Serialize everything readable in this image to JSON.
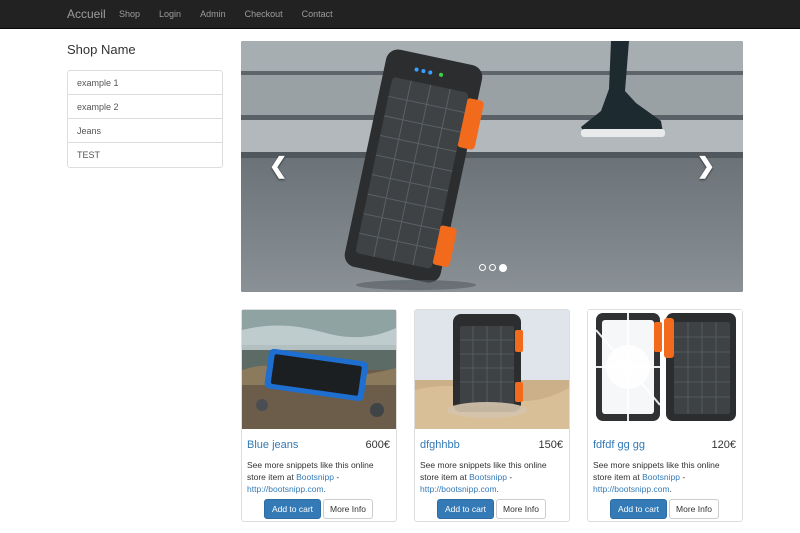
{
  "navbar": {
    "brand": "Accueil",
    "links": [
      "Shop",
      "Login",
      "Admin",
      "Checkout",
      "Contact"
    ]
  },
  "sidebar": {
    "title": "Shop Name",
    "items": [
      "example 1",
      "example 2",
      "Jeans",
      "TEST"
    ]
  },
  "carousel": {
    "prev_icon": "chevron-left-icon",
    "next_icon": "chevron-right-icon",
    "slide_count": 3,
    "active_index": 2
  },
  "products": [
    {
      "title": "Blue jeans",
      "price": "600€",
      "desc_prefix": "See more snippets like this online store item at ",
      "link1": "Bootsnipp",
      "sep": " - ",
      "link2": "http://bootsnipp.com",
      "suffix": ".",
      "cart_label": "Add to cart",
      "info_label": "More Info"
    },
    {
      "title": "dfghhbb",
      "price": "150€",
      "desc_prefix": "See more snippets like this online store item at ",
      "link1": "Bootsnipp",
      "sep": " - ",
      "link2": "http://bootsnipp.com",
      "suffix": ".",
      "cart_label": "Add to cart",
      "info_label": "More Info"
    },
    {
      "title": "fdfdf gg gg",
      "price": "120€",
      "desc_prefix": "See more snippets like this online store item at ",
      "link1": "Bootsnipp",
      "sep": " - ",
      "link2": "http://bootsnipp.com",
      "suffix": ".",
      "cart_label": "Add to cart",
      "info_label": "More Info"
    }
  ],
  "colors": {
    "navbar_bg": "#222222",
    "link_blue": "#337ab7",
    "accent_orange": "#f26b1d"
  }
}
